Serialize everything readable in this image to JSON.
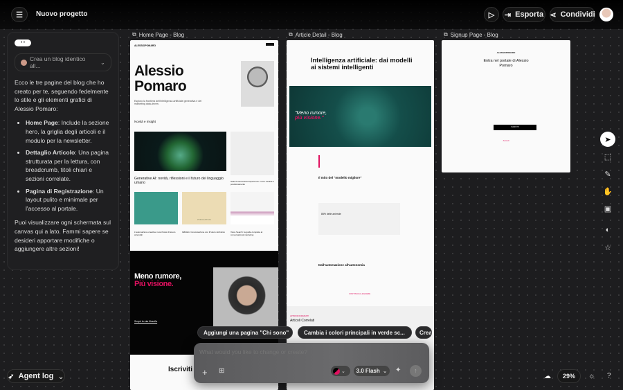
{
  "header": {
    "title": "Nuovo progetto",
    "export_label": "Esporta",
    "share_label": "Condividi"
  },
  "chat": {
    "prompt_chip": "Crea un blog identico all...",
    "intro": "Ecco le tre pagine del blog che ho creato per te, seguendo fedelmente lo stile e gli elementi grafici di Alessio Pomaro:",
    "items": [
      {
        "title": "Home Page",
        "text": ": Include la sezione hero, la griglia degli articoli e il modulo per la newsletter."
      },
      {
        "title": "Dettaglio Articolo",
        "text": ": Una pagina strutturata per la lettura, con breadcrumb, titoli chiari e sezioni correlate."
      },
      {
        "title": "Pagina di Registrazione",
        "text": ": Un layout pulito e minimale per l'accesso al portale."
      }
    ],
    "outro": "Puoi visualizzare ogni schermata sul canvas qui a lato. Fammi sapere se desideri apportare modifiche o aggiungere altre sezioni!"
  },
  "frames": {
    "home": {
      "label": "Home Page - Blog",
      "logo": "ALESSIOPOMARO",
      "hero_title_1": "Alessio",
      "hero_title_2": "Pomaro",
      "hero_sub": "Esploro la frontiera dell'intelligenza artificiale generativa e del marketing data-driven.",
      "section": "Novità e Insight",
      "main_post": "Generative AI: novità, riflessioni e il futuro del linguaggio umano",
      "side_post": "Search Generative Experience: come cambia il posizionamento",
      "posts": [
        "L'automazione creativa: nuovi flussi di lavoro aziendali",
        "IEM-EG: Conversazione con il futuro simbolico",
        "Voice Search: la guida completa al conversational marketing"
      ],
      "card_text": "PODCASTING",
      "dark_title_1": "Meno rumore,",
      "dark_title_2": "Più visione.",
      "dark_link": "Scopri la mia filosofia",
      "newsletter": "Iscriviti"
    },
    "article": {
      "label": "Article Detail - Blog",
      "title": "Intelligenza artificiale: dai modelli ai sistemi intelligenti",
      "quote_1": "\"Meno rumore,",
      "quote_2": "più visione.\"",
      "h2_1": "Il mito del \"modello migliore\"",
      "stat": "85% delle aziende",
      "h2_2": "Dall'automazione all'autonomia",
      "cta": "CONTINUA A LEGGERE",
      "related_tag": "APPROFONDIMENTI",
      "related": "Articoli Correlati"
    },
    "signup": {
      "label": "Signup Page - Blog",
      "logo": "ALESSIOPOMARO",
      "title": "Entra nel portale di Alessio Pomaro",
      "button": "ISCRIVITI",
      "login": "Accedi"
    }
  },
  "suggestions": [
    {
      "text": "Aggiungi una pagina \"Chi sono\"",
      "num": "1"
    },
    {
      "text": "Cambia i colori principali in verde sc...",
      "num": "2"
    },
    {
      "text": "Crea",
      "num": ""
    }
  ],
  "prompt": {
    "placeholder": "What would you like to change or create?",
    "model": "3.0 Flash"
  },
  "footer": {
    "agent_log": "Agent log",
    "zoom": "29%"
  },
  "colors": {
    "accent": "#e0115f",
    "background": "#1d1d1f"
  }
}
